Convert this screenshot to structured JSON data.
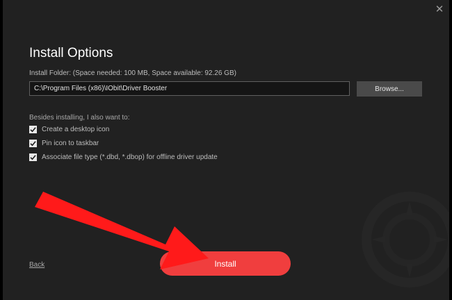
{
  "dialog": {
    "close_glyph": "✕",
    "title": "Install Options",
    "folder_label": "Install Folder: (Space needed: 100 MB, Space available: 92.26 GB)",
    "install_path": "C:\\Program Files (x86)\\IObit\\Driver Booster",
    "browse_label": "Browse...",
    "options_heading": "Besides installing, I also want to:",
    "options": [
      {
        "label": "Create a desktop icon",
        "checked": true
      },
      {
        "label": "Pin icon to taskbar",
        "checked": true
      },
      {
        "label": "Associate file type (*.dbd, *.dbop) for offline driver update",
        "checked": true
      }
    ],
    "back_label": "Back",
    "install_label": "Install"
  },
  "colors": {
    "background": "#212121",
    "accent": "#f03e3e",
    "annotation_arrow": "#ff1a1a"
  }
}
